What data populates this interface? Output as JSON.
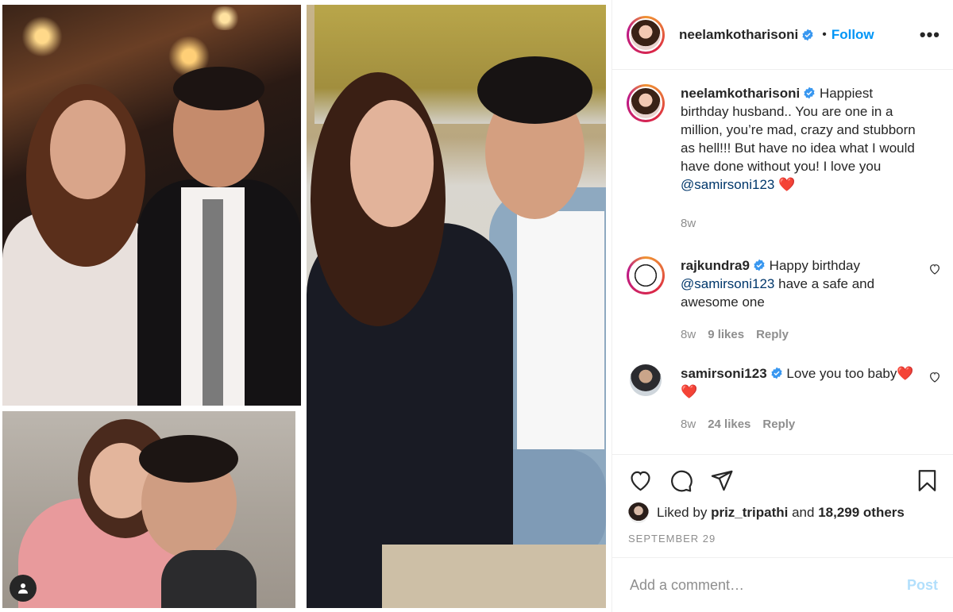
{
  "post": {
    "username": "neelamkotharisoni",
    "follow_label": "Follow",
    "separator": "•",
    "more_label": "•••"
  },
  "caption": {
    "username": "neelamkotharisoni",
    "text": "Happiest birthday husband.. You are one in a million, you’re mad, crazy and stubborn as hell!!! But have no idea what I would have done without you! I love you",
    "mention": "@samirsoni123",
    "emoji": "❤️",
    "time": "8w"
  },
  "comments": [
    {
      "username": "rajkundra9",
      "prefix": "Happy birthday",
      "mention": "@samirsoni123",
      "suffix": "have a safe and awesome one",
      "time": "8w",
      "likes": "9 likes",
      "reply": "Reply"
    },
    {
      "username": "samirsoni123",
      "text": "Love you too baby",
      "emoji": "❤️❤️",
      "time": "8w",
      "likes": "24 likes",
      "reply": "Reply"
    }
  ],
  "likes": {
    "prefix": "Liked by",
    "user": "priz_tripathi",
    "middle": "and",
    "count": "18,299 others"
  },
  "date": "SEPTEMBER 29",
  "add_comment": {
    "placeholder": "Add a comment…",
    "post_label": "Post"
  },
  "colors": {
    "link": "#0095f6",
    "mention": "#00376b",
    "muted": "#8e8e8e",
    "post_disabled": "#b2dffc",
    "heart": "#ed4956"
  },
  "icons": [
    "user-tag-icon",
    "verified-badge-icon",
    "heart-icon",
    "comment-icon",
    "share-icon",
    "bookmark-icon",
    "more-icon"
  ]
}
